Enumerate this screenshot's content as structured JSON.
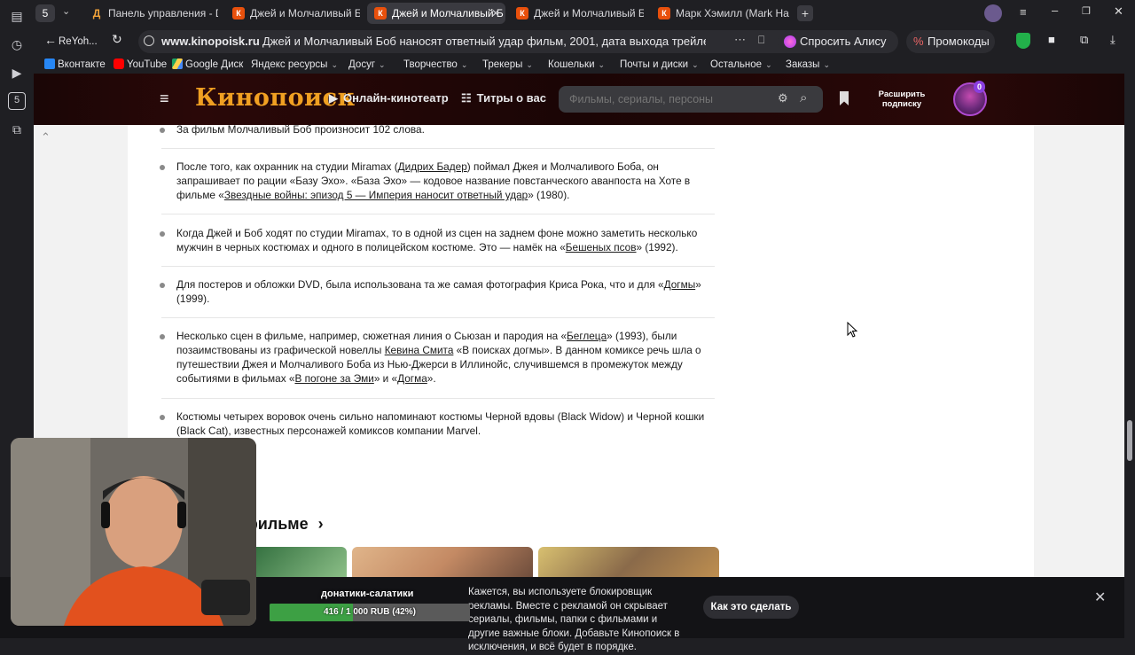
{
  "tabs": {
    "count_badge": "5",
    "items": [
      {
        "title": "Панель управления - Don",
        "favicon": "Д",
        "active": false
      },
      {
        "title": "Джей и Молчаливый Боб",
        "favicon": "К",
        "active": false
      },
      {
        "title": "Джей и Молчаливый Б",
        "favicon": "К",
        "active": true
      },
      {
        "title": "Джей и Молчаливый Боб",
        "favicon": "К",
        "active": false
      },
      {
        "title": "Марк Хэмилл (Mark Hami",
        "favicon": "К",
        "active": false
      }
    ]
  },
  "address_bar": {
    "profile": "ReYoh...",
    "domain": "www.kinopoisk.ru",
    "page_title": "Джей и Молчаливый Боб наносят ответный удар фильм, 2001, дата выхода трейлеры акт...",
    "alice_label": "Спросить Алису AI",
    "promo_label": "Промокоды"
  },
  "bookmarks": [
    {
      "label": "Вконтакте",
      "color": "#2787f5",
      "has_menu": false
    },
    {
      "label": "YouTube",
      "color": "#ff0000",
      "has_menu": false
    },
    {
      "label": "Google Диск",
      "color": "#1fa463",
      "has_menu": false
    },
    {
      "label": "Яндекс ресурсы",
      "color": "",
      "has_menu": true
    },
    {
      "label": "Досуг",
      "color": "",
      "has_menu": true
    },
    {
      "label": "Творчество",
      "color": "",
      "has_menu": true
    },
    {
      "label": "Трекеры",
      "color": "",
      "has_menu": true
    },
    {
      "label": "Кошельки",
      "color": "",
      "has_menu": true
    },
    {
      "label": "Почты и диски",
      "color": "",
      "has_menu": true
    },
    {
      "label": "Остальное",
      "color": "",
      "has_menu": true
    },
    {
      "label": "Заказы",
      "color": "",
      "has_menu": true
    }
  ],
  "kp_header": {
    "logo": "Кинопоиск",
    "nav_online": "Онлайн-кинотеатр",
    "nav_titles": "Титры о вас",
    "search_placeholder": "Фильмы, сериалы, персоны",
    "subscribe": "Расширить подписку",
    "badge": "0"
  },
  "trivia": [
    {
      "html": "За фильм Молчаливый Боб произносит 102 слова."
    },
    {
      "html": "После того, как охранник на студии Miramax (<u>Дидрих Бадер</u>) поймал Джея и Молчаливого Боба, он запрашивает по рации «Базу Эхо». «База Эхо» — кодовое название повстанческого аванпоста на Хоте в фильме «<u>Звездные войны: эпизод 5 — Империя наносит ответный удар</u>» (1980)."
    },
    {
      "html": "Когда Джей и Боб ходят по студии Miramax, то в одной из сцен на заднем фоне можно заметить несколько мужчин в черных костюмах и одного в полицейском костюме. Это — намёк на «<u>Бешеных псов</u>» (1992)."
    },
    {
      "html": "Для постеров и обложки DVD, была использована та же самая фотография Криса Рока, что и для «<u>Догмы</u>» (1999)."
    },
    {
      "html": "Несколько сцен в фильме, например, сюжетная линия о Сьюзан и пародия на «<u>Беглеца</u>» (1993), были позаимствованы из графической новеллы <u>Кевина Смита</u> «В поисках догмы». В данном комиксе речь шла о путешествии Джея и Молчаливого Боба из Нью-Джерси в Иллинойс, случившемся в промежуток между событиями в фильмах «<u>В погоне за Эми</u>» и «<u>Догма</u>»."
    },
    {
      "html": "Костюмы четырех воровок очень сильно напоминают костюмы Черной вдовы (Black Widow) и Черной кошки (Black Cat), известных персонажей комиксов компании Marvel."
    }
  ],
  "partial_button_tail": "е",
  "section_title_tail": "о фильме",
  "ad_banner": {
    "text": "Кажется, вы используете блокировщик рекламы. Вместе с рекламой он скрывает сериалы, фильмы, папки с фильмами и другие важные блоки. Добавьте Кинопоиск в исключения, и всё будет в порядке.",
    "button": "Как это сделать"
  },
  "donation": {
    "title": "донатики-салатики",
    "label": "416 / 1 000 RUB (42%)",
    "progress": 0.416
  },
  "colors": {
    "kp_orange": "#f0a022",
    "tab_active": "#3a3a40",
    "donation_green": "#3da044"
  }
}
